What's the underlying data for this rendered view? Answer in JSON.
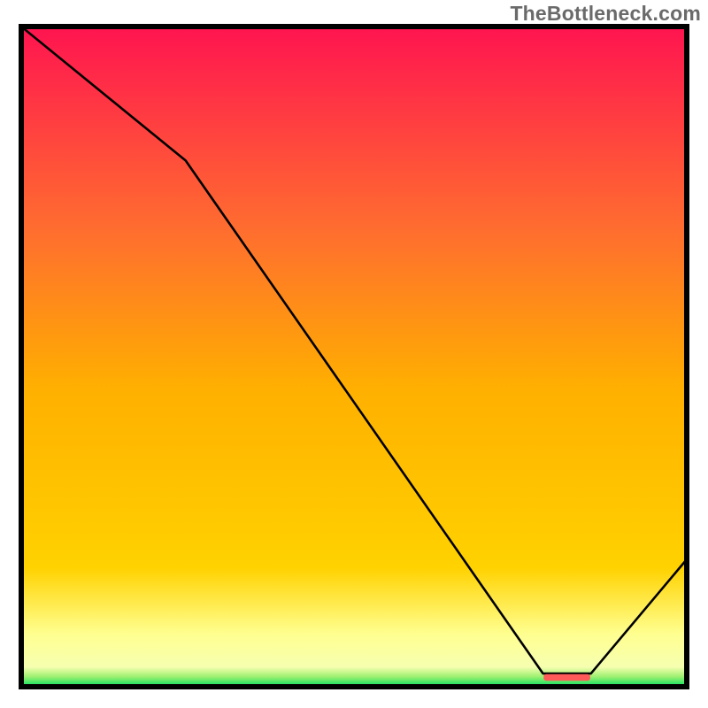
{
  "watermark": "TheBottleneck.com",
  "chart_data": {
    "type": "line",
    "title": "",
    "xlabel": "",
    "ylabel": "",
    "xlim": [
      0,
      100
    ],
    "ylim": [
      0,
      100
    ],
    "grid": false,
    "legend": false,
    "background_gradient": {
      "top_color": "#ff1450",
      "mid_color": "#ffd200",
      "bottom_color": "#00e060",
      "yellow_band_start": 84,
      "green_band_start": 97
    },
    "series": [
      {
        "name": "bottleneck-curve",
        "x": [
          0,
          24.7,
          78.4,
          85.6,
          100
        ],
        "y": [
          100,
          79.7,
          2.0,
          2.0,
          19.3
        ]
      }
    ],
    "marker": {
      "name": "optimal-range",
      "shape": "rounded-rect",
      "x_center": 82.0,
      "y": 1.4,
      "width": 7.0,
      "height": 1.0,
      "color": "#ff5a5a"
    }
  }
}
